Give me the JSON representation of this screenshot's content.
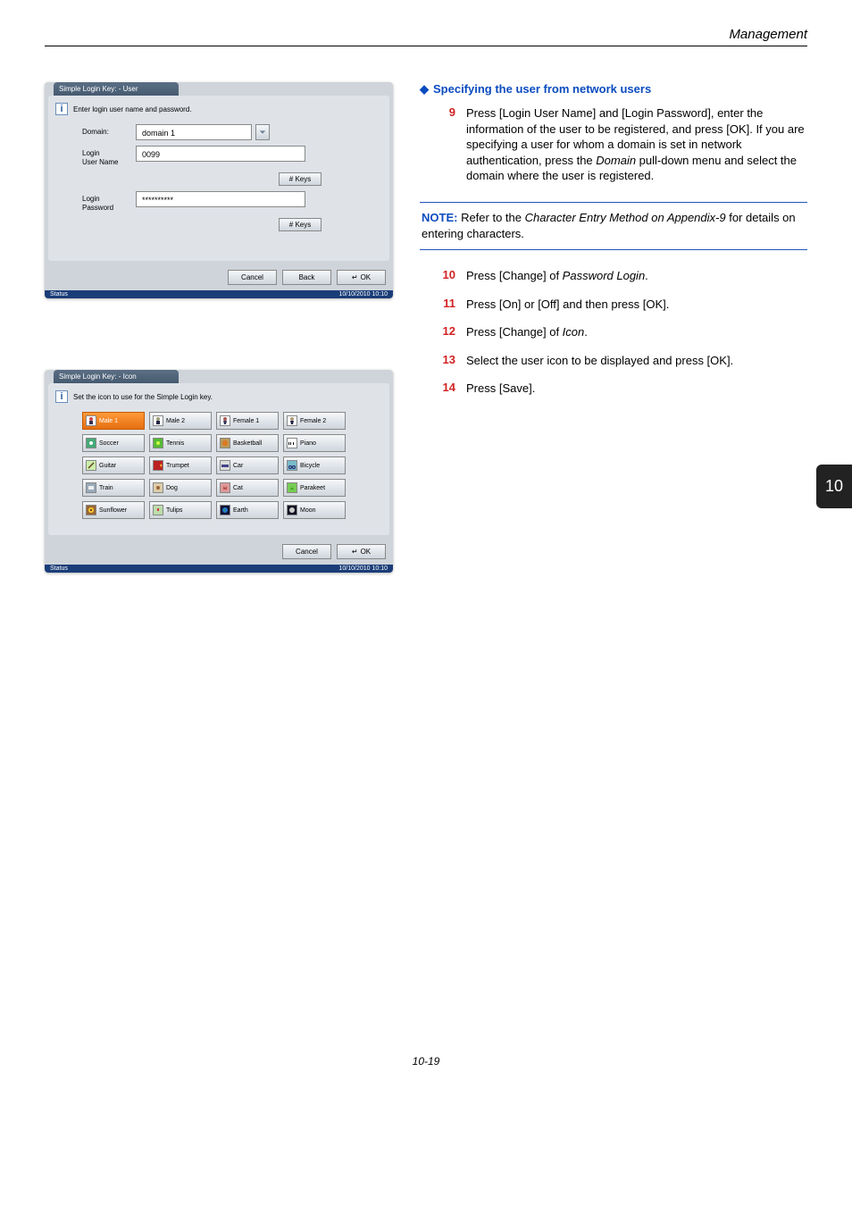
{
  "page": {
    "header_section": "Management",
    "footer_page": "10-19",
    "tab_number": "10"
  },
  "panel1": {
    "title": "Simple Login Key: - User",
    "info": "Enter login user name and password.",
    "domain_label": "Domain:",
    "domain_value": "domain 1",
    "user_label": "Login\nUser Name",
    "user_value": "0099",
    "pwd_label": "Login\nPassword",
    "pwd_value": "**********",
    "keys": "# Keys",
    "cancel": "Cancel",
    "back": "Back",
    "ok": "OK",
    "status": "Status",
    "timestamp": "10/10/2010   10:10"
  },
  "panel2": {
    "title": "Simple Login Key: - Icon",
    "info": "Set the icon to use for the Simple Login key.",
    "cancel": "Cancel",
    "ok": "OK",
    "status": "Status",
    "timestamp": "10/10/2010   10:10",
    "icons": {
      "r0c0": "Male 1",
      "r0c1": "Male 2",
      "r0c2": "Female 1",
      "r0c3": "Female 2",
      "r1c0": "Soccer",
      "r1c1": "Tennis",
      "r1c2": "Basketball",
      "r1c3": "Piano",
      "r2c0": "Guitar",
      "r2c1": "Trumpet",
      "r2c2": "Car",
      "r2c3": "Bicycle",
      "r3c0": "Train",
      "r3c1": "Dog",
      "r3c2": "Cat",
      "r3c3": "Parakeet",
      "r4c0": "Sunflower",
      "r4c1": "Tulips",
      "r4c2": "Earth",
      "r4c3": "Moon"
    }
  },
  "instructions": {
    "heading": "Specifying the user from network users",
    "step9": "Press [Login User Name] and [Login Password], enter the information of the user to be registered, and press [OK]. If you are specifying a user for whom a domain is set in network authentication, press the Domain pull-down menu and select the domain where the user is registered.",
    "note_label": "NOTE:",
    "note_body": " Refer to the Character Entry Method on Appendix-9 for details on entering characters.",
    "step10": "Press [Change] of Password Login.",
    "step11": "Press [On] or [Off] and then press [OK].",
    "step12": "Press [Change] of Icon.",
    "step13": "Select the user icon to be displayed and press [OK].",
    "step14": "Press [Save].",
    "n9": "9",
    "n10": "10",
    "n11": "11",
    "n12": "12",
    "n13": "13",
    "n14": "14"
  }
}
